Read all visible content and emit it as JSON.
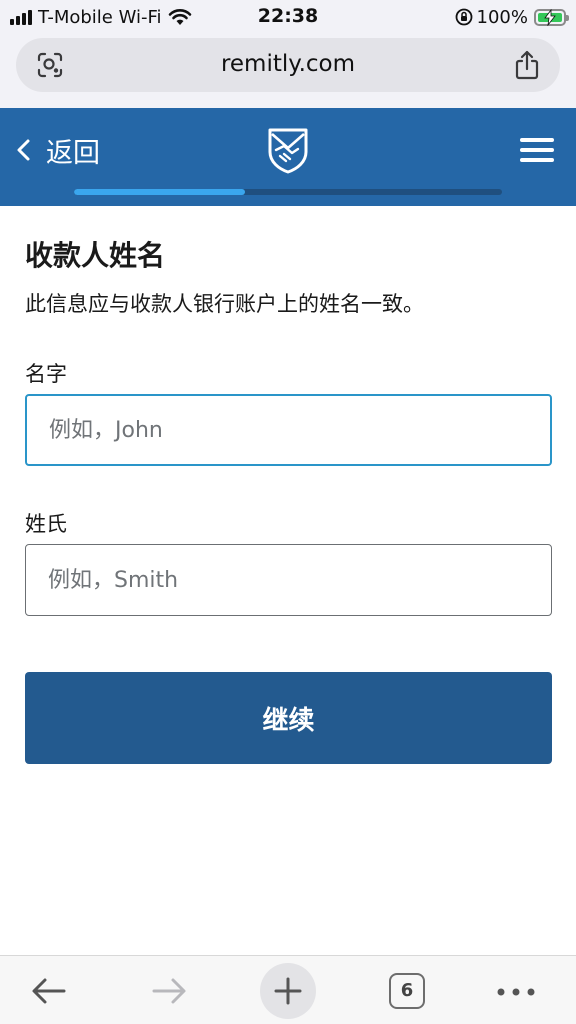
{
  "status_bar": {
    "carrier": "T-Mobile Wi-Fi",
    "time": "22:38",
    "battery_percent": "100%"
  },
  "browser": {
    "url": "remitly.com",
    "tab_count": "6"
  },
  "header": {
    "back_label": "返回",
    "progress_fraction": 0.4,
    "brand_color": "#2567a7",
    "progress_color": "#3aa6ee"
  },
  "form": {
    "title": "收款人姓名",
    "subtitle": "此信息应与收款人银行账户上的姓名一致。",
    "first_name": {
      "label": "名字",
      "placeholder": "例如，John",
      "value": ""
    },
    "last_name": {
      "label": "姓氏",
      "placeholder": "例如，Smith",
      "value": ""
    },
    "continue_label": "继续",
    "button_color": "#235a8f"
  },
  "icons": {
    "status": [
      "signal-icon",
      "wifi-icon",
      "rotation-lock-icon",
      "battery-icon"
    ],
    "browser": [
      "camera-search-icon",
      "share-icon",
      "back-arrow-icon",
      "forward-arrow-icon",
      "plus-icon",
      "tabs-icon",
      "more-icon"
    ],
    "header": [
      "back-chevron-icon",
      "remitly-logo-icon",
      "hamburger-menu-icon"
    ]
  }
}
